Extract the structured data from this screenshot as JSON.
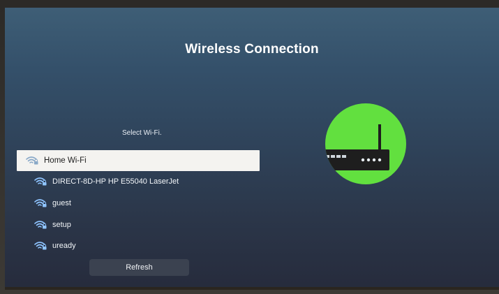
{
  "screen": {
    "title": "Wireless Connection",
    "prompt": "Select Wi-Fi."
  },
  "networks": [
    {
      "label": "Home Wi-Fi",
      "icon": "wifi-secured-icon",
      "selected": true
    },
    {
      "label": "DIRECT-8D-HP HP E55040 LaserJet",
      "icon": "wifi-secured-icon",
      "selected": false
    },
    {
      "label": "guest",
      "icon": "wifi-secured-icon",
      "selected": false
    },
    {
      "label": "setup",
      "icon": "wifi-secured-icon",
      "selected": false
    },
    {
      "label": "uready",
      "icon": "wifi-secured-icon",
      "selected": false
    }
  ],
  "refresh_label": "Refresh",
  "colors": {
    "accent_green": "#62e03f",
    "wifi_icon_blue": "#8fc4ff",
    "selected_bg": "#f4f3f0"
  },
  "illustration": {
    "icon": "router-icon"
  }
}
